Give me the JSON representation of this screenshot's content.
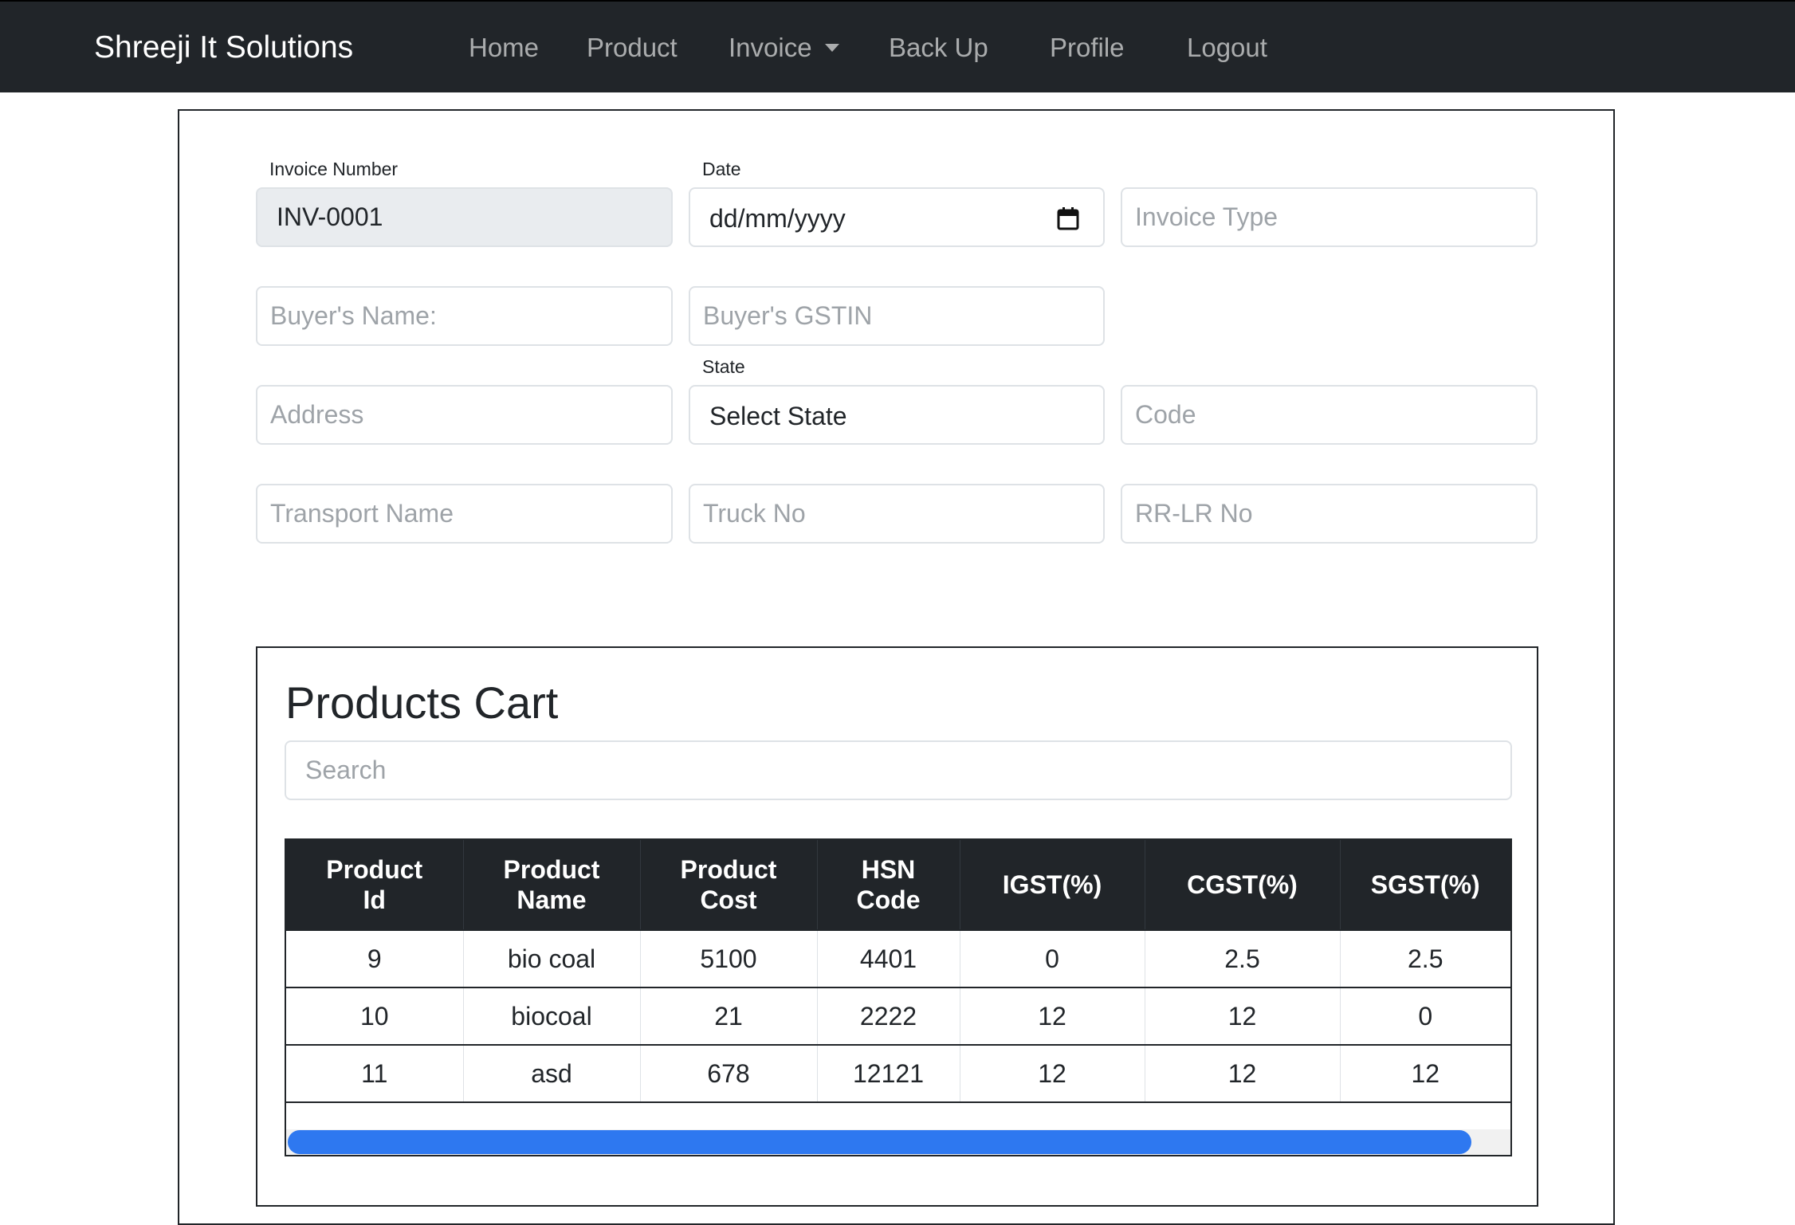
{
  "navbar": {
    "brand": "Shreeji It Solutions",
    "links": {
      "home": "Home",
      "product": "Product",
      "invoice": "Invoice",
      "backup": "Back Up",
      "profile": "Profile",
      "logout": "Logout"
    }
  },
  "form": {
    "invoice_number_label": "Invoice Number",
    "invoice_number_value": "INV-0001",
    "date_label": "Date",
    "date_value": "dd/mm/yyyy",
    "invoice_type_placeholder": "Invoice Type",
    "buyer_name_placeholder": "Buyer's Name:",
    "buyer_gstin_placeholder": "Buyer's GSTIN",
    "state_label": "State",
    "state_value": "Select State",
    "address_placeholder": "Address",
    "code_placeholder": "Code",
    "transport_name_placeholder": "Transport Name",
    "truck_no_placeholder": "Truck No",
    "rr_lr_no_placeholder": "RR-LR No"
  },
  "cart": {
    "title": "Products Cart",
    "search_placeholder": "Search",
    "columns": [
      [
        "Product",
        "Id"
      ],
      [
        "Product",
        "Name"
      ],
      [
        "Product",
        "Cost"
      ],
      [
        "HSN",
        "Code"
      ],
      [
        "IGST(%)"
      ],
      [
        "CGST(%)"
      ],
      [
        "SGST(%)"
      ]
    ],
    "rows": [
      [
        "9",
        "bio coal",
        "5100",
        "4401",
        "0",
        "2.5",
        "2.5"
      ],
      [
        "10",
        "biocoal",
        "21",
        "2222",
        "12",
        "12",
        "0"
      ],
      [
        "11",
        "asd",
        "678",
        "12121",
        "12",
        "12",
        "12"
      ]
    ],
    "horizontal_scroll_visible_fraction": 0.98
  },
  "colors": {
    "navbar_bg": "#212529",
    "scrollbar_thumb": "#2e78f0",
    "readonly_bg": "#e9ecef"
  }
}
